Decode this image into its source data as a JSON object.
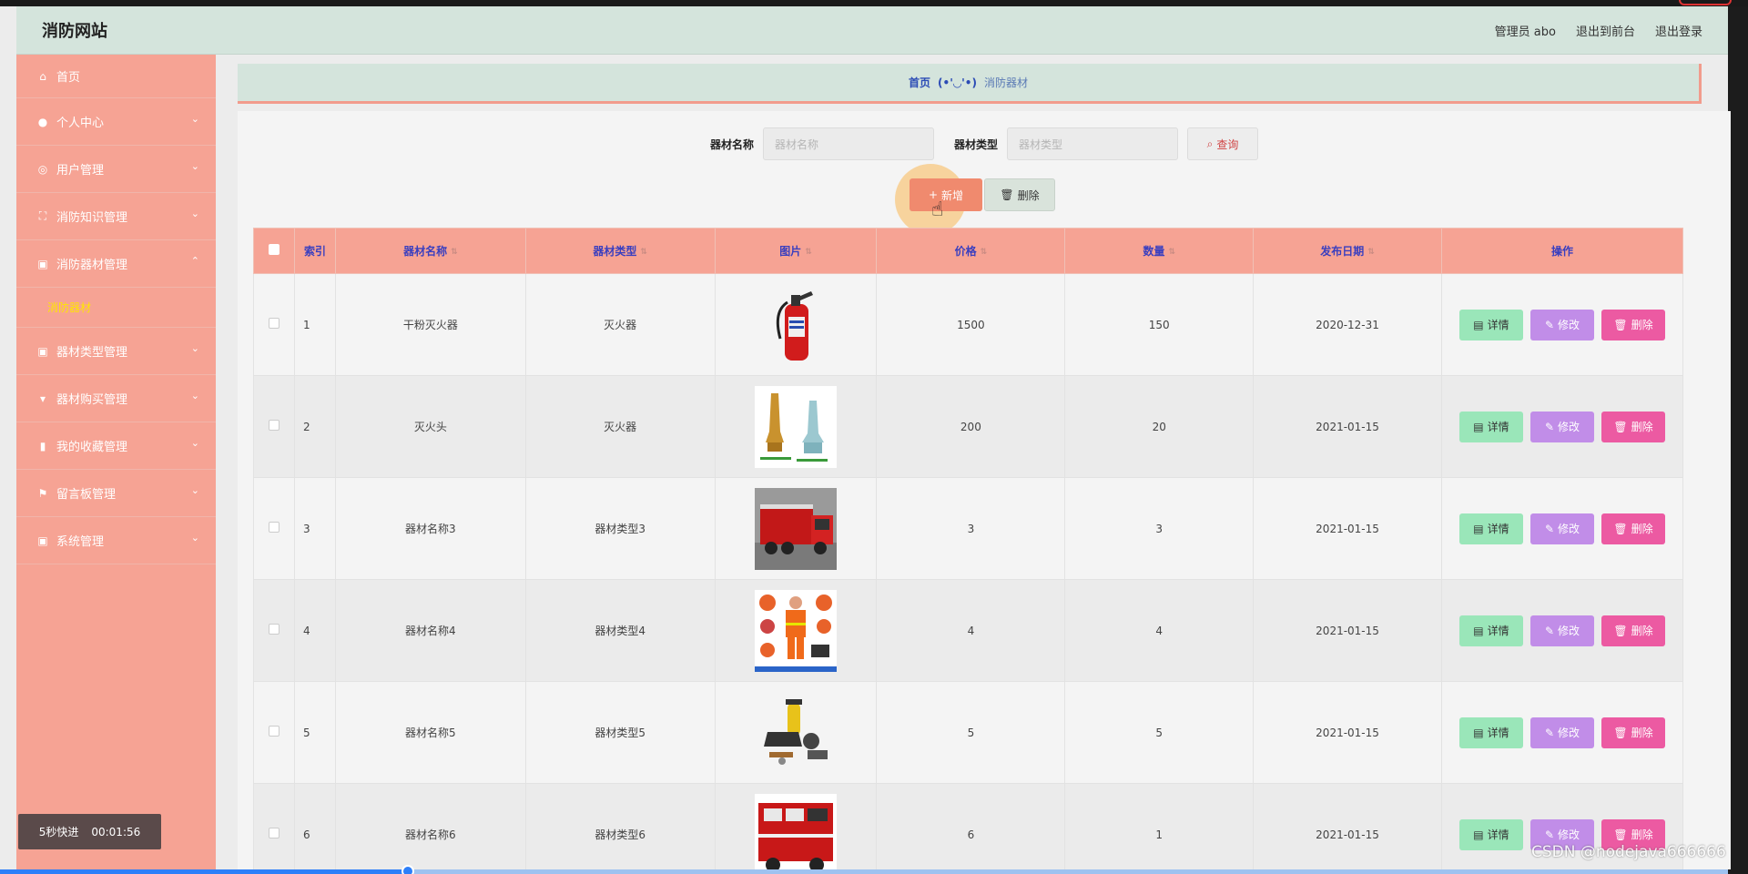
{
  "header": {
    "brand": "消防网站",
    "admin": "管理员 abo",
    "front": "退出到前台",
    "logout": "退出登录"
  },
  "sidebar": {
    "items": [
      {
        "label": "首页",
        "icon": "home-icon"
      },
      {
        "label": "个人中心",
        "icon": "user-icon"
      },
      {
        "label": "用户管理",
        "icon": "globe-icon"
      },
      {
        "label": "消防知识管理",
        "icon": "expand-icon"
      },
      {
        "label": "消防器材管理",
        "icon": "clipboard-icon"
      },
      {
        "label": "器材类型管理",
        "icon": "clipboard-icon"
      },
      {
        "label": "器材购买管理",
        "icon": "cart-icon"
      },
      {
        "label": "我的收藏管理",
        "icon": "bookmark-icon"
      },
      {
        "label": "留言板管理",
        "icon": "flag-icon"
      },
      {
        "label": "系统管理",
        "icon": "clipboard-icon"
      }
    ],
    "sub_item": "消防器材"
  },
  "breadcrumb": {
    "home": "首页",
    "sep": "(•'◡'•)",
    "current": "消防器材"
  },
  "search": {
    "name_label": "器材名称",
    "name_placeholder": "器材名称",
    "type_label": "器材类型",
    "type_placeholder": "器材类型",
    "query": "查询"
  },
  "actions": {
    "add": "新增",
    "delete": "删除"
  },
  "table": {
    "headers": [
      "索引",
      "器材名称",
      "器材类型",
      "图片",
      "价格",
      "数量",
      "发布日期",
      "操作"
    ],
    "op_detail": "详情",
    "op_edit": "修改",
    "op_delete": "删除",
    "rows": [
      {
        "idx": "1",
        "name": "干粉灭火器",
        "type": "灭火器",
        "price": "1500",
        "qty": "150",
        "date": "2020-12-31"
      },
      {
        "idx": "2",
        "name": "灭火头",
        "type": "灭火器",
        "price": "200",
        "qty": "20",
        "date": "2021-01-15"
      },
      {
        "idx": "3",
        "name": "器材名称3",
        "type": "器材类型3",
        "price": "3",
        "qty": "3",
        "date": "2021-01-15"
      },
      {
        "idx": "4",
        "name": "器材名称4",
        "type": "器材类型4",
        "price": "4",
        "qty": "4",
        "date": "2021-01-15"
      },
      {
        "idx": "5",
        "name": "器材名称5",
        "type": "器材类型5",
        "price": "5",
        "qty": "5",
        "date": "2021-01-15"
      },
      {
        "idx": "6",
        "name": "器材名称6",
        "type": "器材类型6",
        "price": "6",
        "qty": "1",
        "date": "2021-01-15"
      }
    ]
  },
  "player": {
    "timer_label": "5秒快进",
    "timer_time": "00:01:56",
    "progress": 0.236
  },
  "watermark": "CSDN @nodejava666666",
  "colors": {
    "sidebar": "#f6a394",
    "header": "#d4e4dc",
    "accent_red": "#f08a6e",
    "detail": "#9ae6b9",
    "edit": "#c18de8",
    "delete": "#ec5aa2"
  }
}
